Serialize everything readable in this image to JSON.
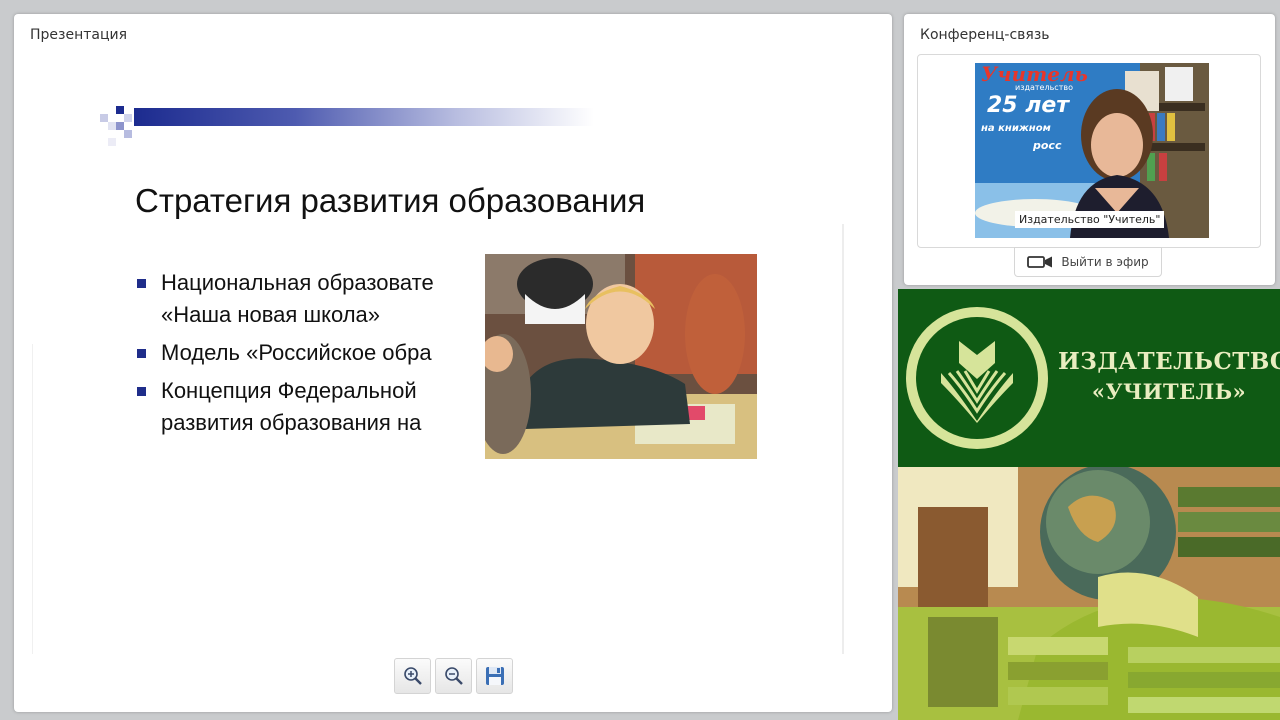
{
  "presentation": {
    "panel_title": "Презентация",
    "slide": {
      "title": "Стратегия развития образования",
      "bullets": [
        {
          "line1": "Национальная образовате",
          "line2": "«Наша новая школа»"
        },
        {
          "line1": "Модель «Российское обра",
          "line2": ""
        },
        {
          "line1": "Концепция Федеральной",
          "line2": "развития образования на"
        }
      ]
    },
    "toolbar": {
      "zoom_in_icon": "zoom-in-icon",
      "zoom_out_icon": "zoom-out-icon",
      "save_icon": "save-icon"
    }
  },
  "conference": {
    "panel_title": "Конференц-связь",
    "video_caption": "Издательство \"Учитель\"",
    "poster": {
      "line1": "Учитель",
      "line2": "издательство",
      "line3": "25 лет",
      "line4": "на книжном",
      "line5": "росс"
    },
    "go_live_label": "Выйти в эфир",
    "go_live_icon": "camera-icon"
  },
  "banner": {
    "brand_line1": "ИЗДАТЕЛЬСТВО",
    "brand_line2": "«УЧИТЕЛЬ»"
  },
  "colors": {
    "banner_green": "#0f5a14",
    "logo_light": "#d6e49a",
    "bullet_navy": "#1f2d8a"
  }
}
